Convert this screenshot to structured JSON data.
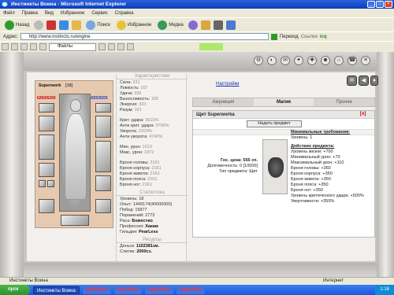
{
  "window": {
    "title": "Инстинкты Воина - Microsoft Internet Explorer",
    "min": "_",
    "max": "□",
    "close": "×"
  },
  "menu": [
    "Файл",
    "Правка",
    "Вид",
    "Избранное",
    "Сервис",
    "Справка"
  ],
  "toolbar": {
    "back": "Назад",
    "search": "Поиск",
    "favorites": "Избранное",
    "media": "Медиа"
  },
  "address": {
    "label": "Адрес:",
    "url": "http://www.instincts.ru/engine",
    "go": "Переход",
    "links": "Ссылки",
    "icq": "icq"
  },
  "linksbar": {
    "dropdown": "Файлы"
  },
  "topicons": [
    "⚙",
    "◐",
    "✉",
    "✦",
    "✚",
    "☻",
    "⌂",
    "☎",
    "✕"
  ],
  "character": {
    "name": "Superwork",
    "level": "[18]",
    "hp": "6260/6260",
    "mp": "5555/5555"
  },
  "stats": {
    "title": "Характеристики",
    "rows": [
      {
        "label": "Сила:",
        "value": "231"
      },
      {
        "label": "Ловкость:",
        "value": "167"
      },
      {
        "label": "Удача:",
        "value": "336"
      },
      {
        "label": "Выносливость:",
        "value": "165"
      },
      {
        "label": "Энергия:",
        "value": "333"
      },
      {
        "label": "Разум:",
        "value": "101"
      }
    ],
    "mods": [
      {
        "label": "Крит. удара:",
        "value": "3610%"
      },
      {
        "label": "Анти крит. удара:",
        "value": "3700%"
      },
      {
        "label": "Уворота:",
        "value": "2203%"
      },
      {
        "label": "Анти уворота:",
        "value": "4740%"
      }
    ],
    "damage": [
      {
        "label": "Мин. урон:",
        "value": "1613"
      },
      {
        "label": "Макс. урон:",
        "value": "1872"
      }
    ],
    "armor": [
      {
        "label": "Броня головы:",
        "value": "2161"
      },
      {
        "label": "Броня корпуса:",
        "value": "2161"
      },
      {
        "label": "Броня живота:",
        "value": "2161"
      },
      {
        "label": "Броня пояса:",
        "value": "2161"
      },
      {
        "label": "Броня ног:",
        "value": "2161"
      }
    ],
    "stat_title": "Статистика",
    "info": [
      {
        "label": "Уровень:",
        "value": "18"
      },
      {
        "label": "Опыт:",
        "value": "1449174(40000000)"
      },
      {
        "label": "Побед:",
        "value": "15877"
      },
      {
        "label": "Поражений:",
        "value": "2773"
      },
      {
        "label": "Раса:",
        "value": "Божество"
      },
      {
        "label": "Профессия:",
        "value": "Хакам"
      },
      {
        "label": "Гильдия:",
        "value": "PearLess"
      }
    ],
    "res_title": "Ресурсы",
    "res": [
      {
        "label": "Деньги:",
        "value": "1102381зм."
      },
      {
        "label": "Слитки:",
        "value": "2000сз."
      }
    ]
  },
  "right": {
    "settings": "Настройки",
    "buttons": [
      "✉",
      "◀",
      "●"
    ],
    "tabs": [
      "Амуниция",
      "Магия",
      "Прочее"
    ],
    "active_tab": "Магия",
    "item": {
      "header": "Щит Superworka",
      "close": "[x]",
      "button": "Надеть предмет",
      "price": "Гос. цена: 555 сп.",
      "durability": "Долговечность: 0 [10000]",
      "type": "Тип предмета: Щит",
      "req_title": "Минимальные требования:",
      "req_level": "Уровень: 1",
      "effect_title": "Действие предмета:",
      "effects": [
        "Уровень жизни: +700",
        "Минимальный урон: +70",
        "Максимальный урон: +110",
        "Броня головы: +350",
        "Броня корпуса: +350",
        "Броня живота: +350",
        "Броня пояса: +350",
        "Броня ног: +350",
        "Уровень критического удара: +500%",
        "Увертливости: +350%"
      ]
    }
  },
  "status": {
    "text": "Инстинкты Воина",
    "zone": "Интернет"
  },
  "taskbar": {
    "start": "пуск",
    "tasks": [
      "Инстинкты Воина",
      "ЦЕНЗУРА",
      "ЦЕНЗУРА",
      "ЦЕНЗУРА",
      "ЦЕНЗУРА"
    ],
    "clock": "1:16"
  },
  "colors": {
    "hp": "#cc0000",
    "mp": "#1b3fd0",
    "panel": "#e7c9b0"
  }
}
